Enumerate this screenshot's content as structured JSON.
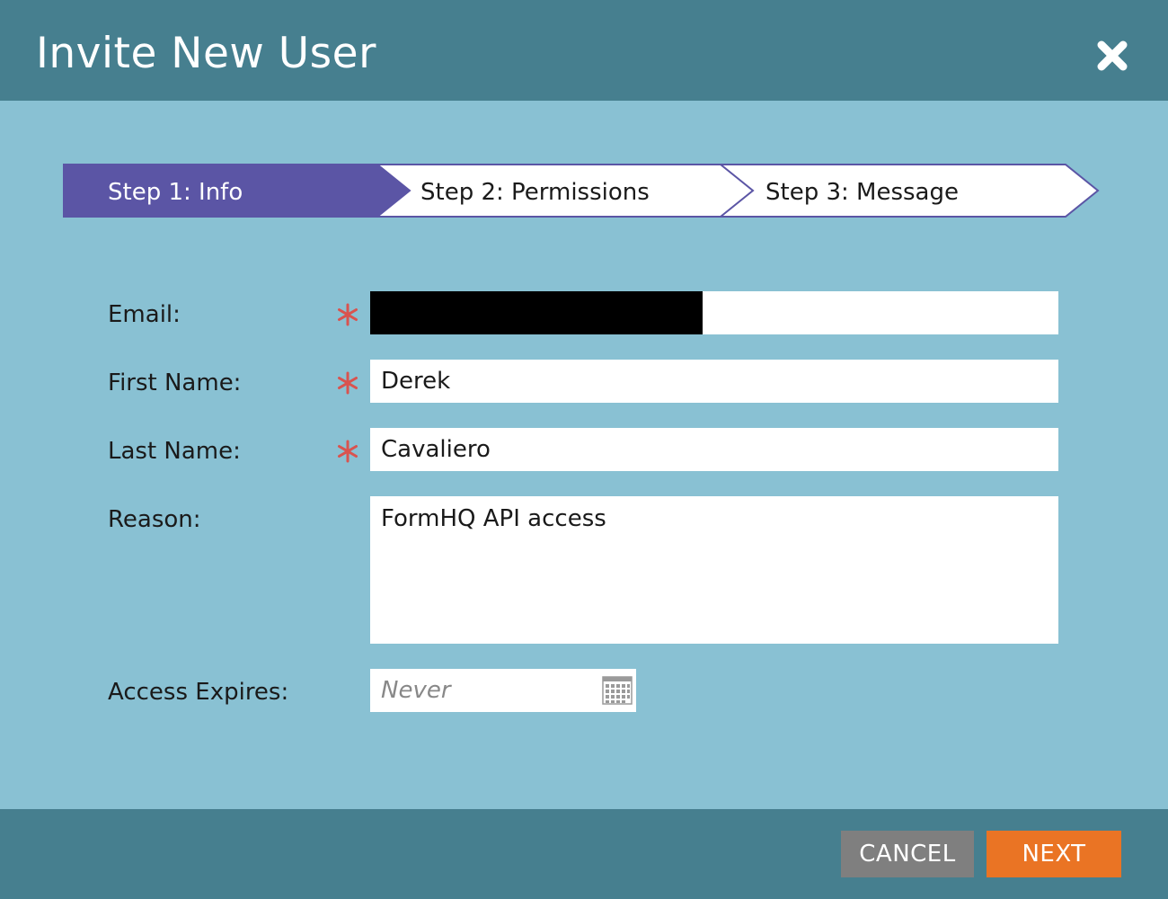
{
  "dialog": {
    "title": "Invite New User",
    "close_icon": "close-icon"
  },
  "wizard": {
    "steps": [
      {
        "label": "Step 1: Info",
        "active": true
      },
      {
        "label": "Step 2: Permissions",
        "active": false
      },
      {
        "label": "Step 3: Message",
        "active": false
      }
    ],
    "colors": {
      "active_fill": "#5b55a5",
      "inactive_fill": "#ffffff",
      "border": "#5b55a5"
    }
  },
  "form": {
    "email": {
      "label": "Email:",
      "required": true,
      "value": ""
    },
    "first_name": {
      "label": "First Name:",
      "required": true,
      "value": "Derek"
    },
    "last_name": {
      "label": "Last Name:",
      "required": true,
      "value": "Cavaliero"
    },
    "reason": {
      "label": "Reason:",
      "required": false,
      "value": "FormHQ API access"
    },
    "access_expires": {
      "label": "Access Expires:",
      "placeholder": "Never",
      "icon": "calendar-icon"
    },
    "required_color": "#d9534f"
  },
  "footer": {
    "cancel_label": "CANCEL",
    "next_label": "NEXT",
    "cancel_color": "#7f7f7f",
    "next_color": "#ea7424"
  },
  "colors": {
    "header_bg": "#467f8f",
    "body_bg": "#89c1d3"
  }
}
